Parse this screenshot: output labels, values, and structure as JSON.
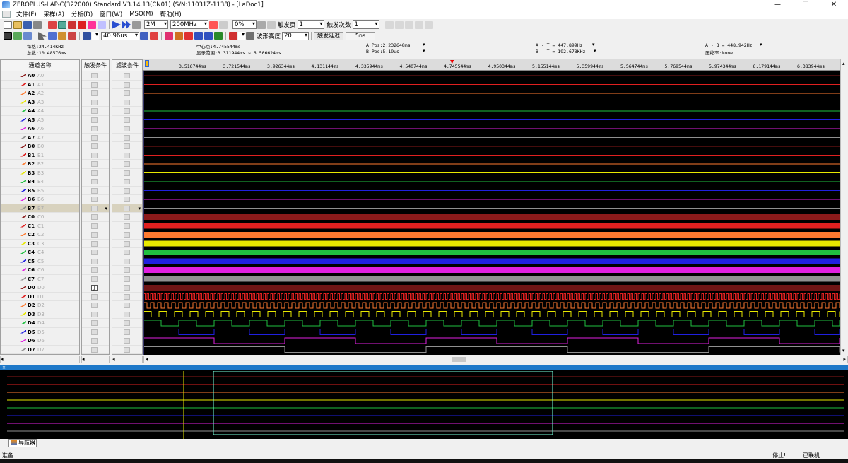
{
  "window": {
    "title": "ZEROPLUS-LAP-C(322000) Standard V3.14.13(CN01) (S/N:11031Z-1138) - [LaDoc1]"
  },
  "menu": [
    "文件(F)",
    "采样(A)",
    "分析(D)",
    "窗口(W)",
    "MSO(M)",
    "帮助(H)"
  ],
  "toolbar": {
    "memory_depth": "2M",
    "sample_rate": "200MHz",
    "trigger_percent": "0%",
    "trigger_page_label": "触发页",
    "trigger_page": "1",
    "trigger_count_label": "触发次数",
    "trigger_count": "1",
    "time_div": "40.96us",
    "wave_height_label": "波形高度",
    "wave_height": "20",
    "trigger_delay_label": "触发延迟",
    "trigger_delay": "5ns"
  },
  "info": {
    "per_div": "每格:24.414KHz",
    "total": "总数:10.48576ms",
    "center": "中心点:4.745544ms",
    "display_range": "显示范围:3.311944ms ~ 6.506624ms",
    "a_pos": "A Pos:2.232648ms",
    "b_pos": "B Pos:5.19us",
    "a_minus_t": "A - T = 447.899Hz",
    "b_minus_t": "B - T = 192.678KHz",
    "a_minus_b": "A - B = 448.942Hz",
    "compression": "压缩率:None"
  },
  "columns": {
    "name": "通道名称",
    "trigger": "触发条件",
    "filter": "滤波条件"
  },
  "channels": [
    {
      "name": "A0",
      "alias": "A0",
      "color": "#8b1a1a"
    },
    {
      "name": "A1",
      "alias": "A1",
      "color": "#e02020"
    },
    {
      "name": "A2",
      "alias": "A2",
      "color": "#ff7a30"
    },
    {
      "name": "A3",
      "alias": "A3",
      "color": "#e8e800"
    },
    {
      "name": "A4",
      "alias": "A4",
      "color": "#20c040"
    },
    {
      "name": "A5",
      "alias": "A5",
      "color": "#2020e0"
    },
    {
      "name": "A6",
      "alias": "A6",
      "color": "#e020e0"
    },
    {
      "name": "A7",
      "alias": "A7",
      "color": "#909090"
    },
    {
      "name": "B0",
      "alias": "B0",
      "color": "#8b1a1a"
    },
    {
      "name": "B1",
      "alias": "B1",
      "color": "#e02020"
    },
    {
      "name": "B2",
      "alias": "B2",
      "color": "#ff7a30"
    },
    {
      "name": "B3",
      "alias": "B3",
      "color": "#e8e800"
    },
    {
      "name": "B4",
      "alias": "B4",
      "color": "#20c040"
    },
    {
      "name": "B5",
      "alias": "B5",
      "color": "#2020e0"
    },
    {
      "name": "B6",
      "alias": "B6",
      "color": "#e020e0"
    },
    {
      "name": "B7",
      "alias": "B7",
      "color": "#909090"
    },
    {
      "name": "C0",
      "alias": "C0",
      "color": "#8b1a1a"
    },
    {
      "name": "C1",
      "alias": "C1",
      "color": "#e02020"
    },
    {
      "name": "C2",
      "alias": "C2",
      "color": "#ff7a30"
    },
    {
      "name": "C3",
      "alias": "C3",
      "color": "#e8e800"
    },
    {
      "name": "C4",
      "alias": "C4",
      "color": "#20c040"
    },
    {
      "name": "C5",
      "alias": "C5",
      "color": "#2020e0"
    },
    {
      "name": "C6",
      "alias": "C6",
      "color": "#e020e0"
    },
    {
      "name": "C7",
      "alias": "C7",
      "color": "#909090"
    },
    {
      "name": "D0",
      "alias": "D0",
      "color": "#8b1a1a"
    },
    {
      "name": "D1",
      "alias": "D1",
      "color": "#e02020"
    },
    {
      "name": "D2",
      "alias": "D2",
      "color": "#ff7a30"
    },
    {
      "name": "D3",
      "alias": "D3",
      "color": "#e8e800"
    },
    {
      "name": "D4",
      "alias": "D4",
      "color": "#20c040"
    },
    {
      "name": "D5",
      "alias": "D5",
      "color": "#2020e0"
    },
    {
      "name": "D6",
      "alias": "D6",
      "color": "#e020e0"
    },
    {
      "name": "D7",
      "alias": "D7",
      "color": "#909090"
    }
  ],
  "ruler_ticks": [
    "3.516744ms",
    "3.721544ms",
    "3.926344ms",
    "4.131144ms",
    "4.335944ms",
    "4.540744ms",
    "4.745544ms",
    "4.950344ms",
    "5.155144ms",
    "5.359944ms",
    "5.564744ms",
    "5.769544ms",
    "5.974344ms",
    "6.179144ms",
    "6.383944ms"
  ],
  "navigator": {
    "tab_label": "导航器"
  },
  "status": {
    "ready": "准备",
    "stopped": "停止!",
    "connected": "已联机"
  }
}
